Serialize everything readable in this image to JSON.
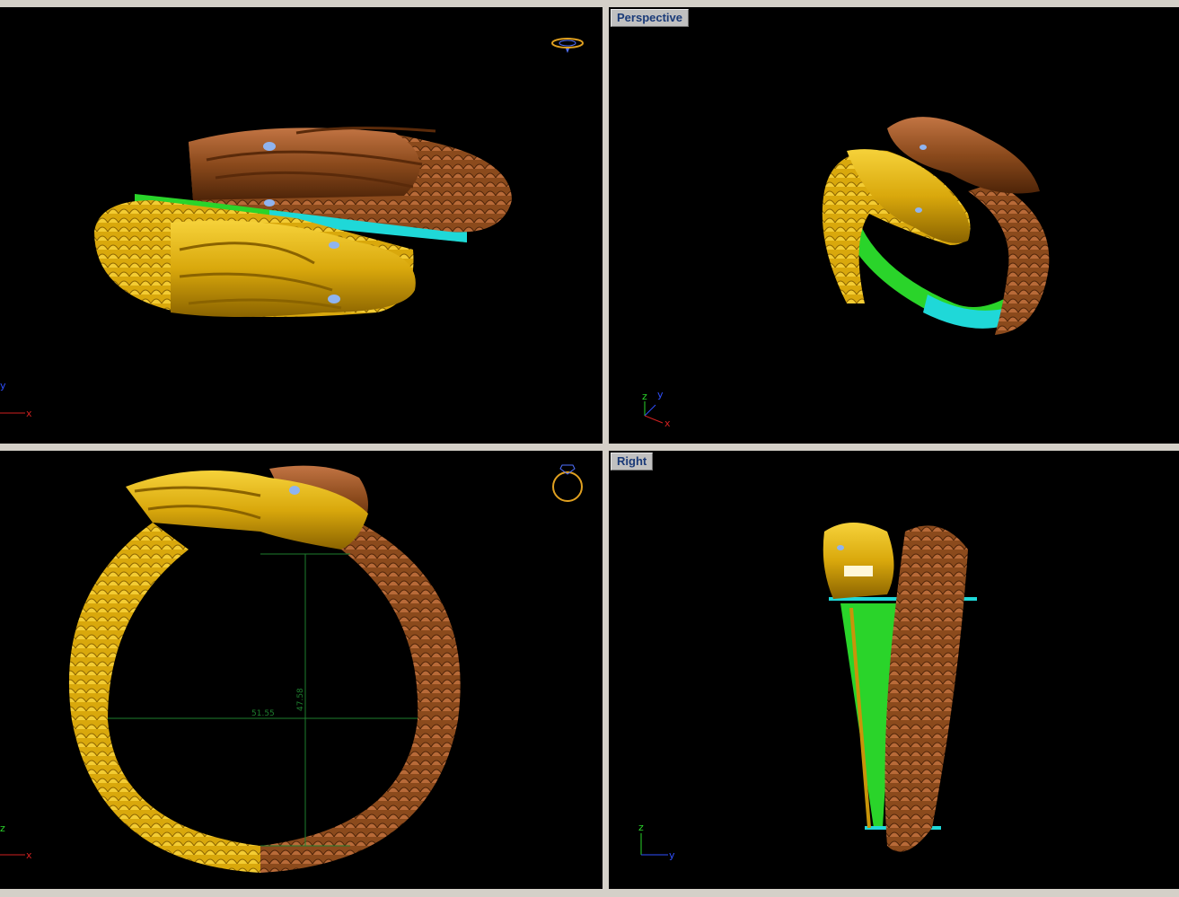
{
  "viewports": {
    "top_left": {
      "title": "",
      "axes": [
        "y",
        "x"
      ]
    },
    "perspective": {
      "title": "Perspective",
      "axes": [
        "z",
        "y",
        "x"
      ]
    },
    "bottom_left": {
      "title": "",
      "axes": [
        "z",
        "x"
      ]
    },
    "right": {
      "title": "Right",
      "axes": [
        "z",
        "y"
      ]
    }
  },
  "dimensions": {
    "horizontal": "51.55",
    "vertical": "47.58"
  },
  "colors": {
    "gold": "#d9a80c",
    "bronze": "#8b4a1c",
    "green": "#2ad42a",
    "cyan": "#1fd8d8",
    "eye": "#8fb4f0",
    "background": "#000000",
    "frame": "#d4d0c8"
  },
  "icons": [
    "ring-icon",
    "ring-icon"
  ]
}
